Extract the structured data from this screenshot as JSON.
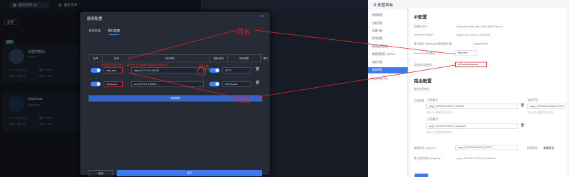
{
  "background_app": {
    "tabs": [
      "服务列表 (3)",
      "服务发布"
    ],
    "filter_label": "全部",
    "status_badge": "运行",
    "cards": [
      {
        "name": "远程控制台",
        "sub": "Xavier",
        "rows": [
          "IP：172.16.0.1",
          "端口: 8080",
          "状态：运行中",
          "CPU：3%"
        ]
      },
      {
        "name": "StarRiver",
        "sub": "StarRiver",
        "rows": [
          "IP：172.16.0.2",
          "端口: 9090",
          "状态：运行中",
          "CPU：5%"
        ]
      }
    ]
  },
  "modal": {
    "title": "服务配置",
    "tabs": [
      "基础配置",
      "端口配置"
    ],
    "active_tab": 1,
    "columns": [
      "启用",
      "名称",
      "目标地址",
      "鉴权启用",
      "协议类型",
      "操作"
    ],
    "rows": [
      {
        "name": "dab_tree",
        "target": "https://127.0.0.1:58443",
        "protocol": "HTTP"
      },
      {
        "name": "rsCamera",
        "target": "ws://127.0.0.1:58443",
        "protocol": "WebSocket"
      }
    ],
    "add_button": "添加映射",
    "cancel_button": "取消",
    "save_button": "保存",
    "annotation_text": "先配置好映射路径，路径名是前端接口使用的uri路径",
    "annotation_open": "开启"
  },
  "annotations": {
    "same_name_1": "同名",
    "same_name_2": "同名"
  },
  "right_panel": {
    "title": "配置面板",
    "sidebar": [
      "基础配置",
      "功能页面",
      "设备列表",
      "插件配置",
      "服务配置管理",
      "数据源配置 (10/Pro)",
      "电机列表",
      "数据映射",
      "StarRiver Pro"
    ],
    "active_index": 7,
    "section_ip": "IP配置",
    "fields": [
      {
        "label": "设备标识ID：",
        "value": "3f2aadbe-5b6b-48c4-9809-fa2f97abccf7"
      },
      {
        "label": "StarRiver 节点IP：",
        "value": "https://192.168.122.32:55445"
      },
      {
        "label": "接入服务 (websocket路径服务器)：",
        "value": "wpdemo458"
      },
      {
        "label": "StarRiver对外路径：",
        "value": "dab_tree"
      },
      {
        "label": "视频流代理路径：",
        "value": "/stCamera/camera"
      }
    ],
    "section_route": "路由配置",
    "route_label": "路由首页地址：",
    "page_route_label": "页面配置：",
    "page_col_label": "页面路径",
    "page_col2_label": "路由序号",
    "page_inputs": [
      "page_2024061016015_789bfe8",
      "page_20240617000075_a6ebd15"
    ],
    "page_right_input": "page_20240610184023_67979",
    "hint_text": "请输入您 (模组程序的名称)",
    "home_page_label": "数据首页 (PageId)：",
    "home_page_value": "page_20240610184023_67979",
    "visual_page_label": "数据驱动：",
    "visual_page_value": "数据驱动",
    "default_page_label": "默认首页地址 (PageId)：",
    "default_page_value": "page_20240617000045_6d61b0e"
  },
  "colors": {
    "accent": "#3d79ec",
    "annotation": "#e22424",
    "modal_bg": "#262b36",
    "panel_bg": "#ffffff"
  }
}
